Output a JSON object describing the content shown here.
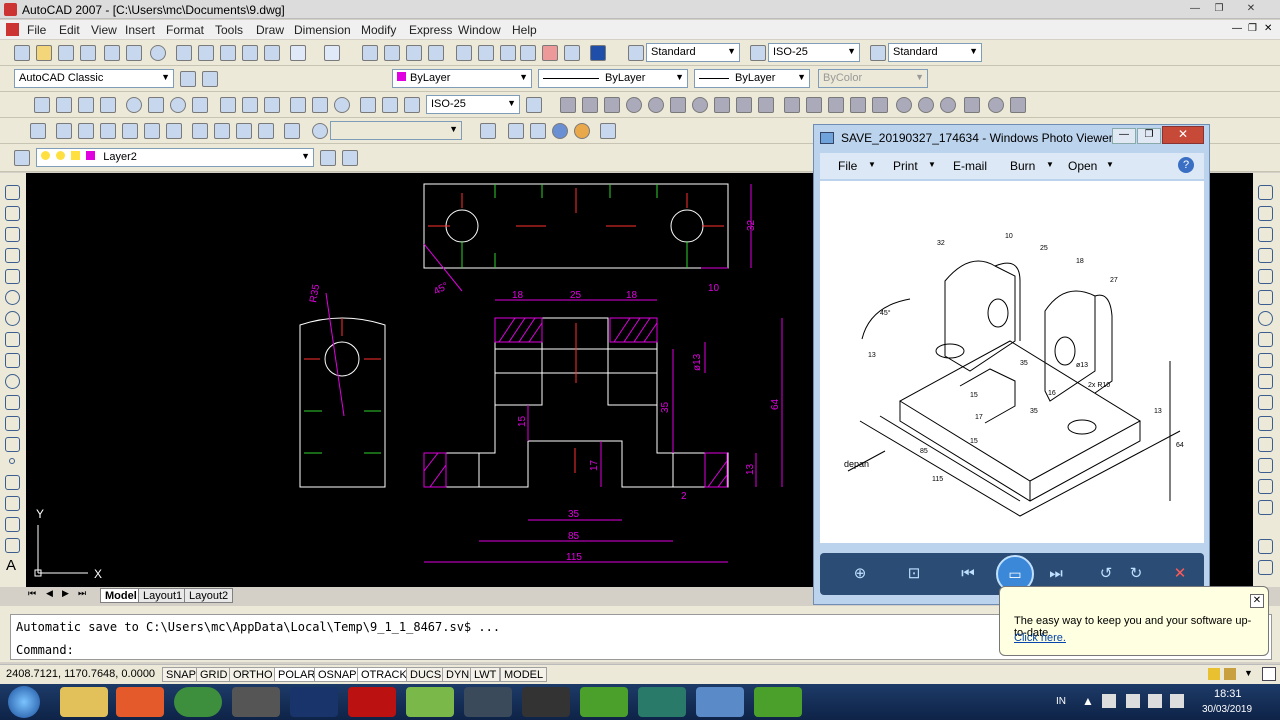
{
  "window": {
    "title": "AutoCAD 2007 - [C:\\Users\\mc\\Documents\\9.dwg]"
  },
  "menu": [
    "File",
    "Edit",
    "View",
    "Insert",
    "Format",
    "Tools",
    "Draw",
    "Dimension",
    "Modify",
    "Express",
    "Window",
    "Help"
  ],
  "toolbar": {
    "text_style": "Standard",
    "dim_style": "ISO-25",
    "table_style": "Standard",
    "workspace": "AutoCAD Classic",
    "color": "ByLayer",
    "linetype": "ByLayer",
    "lineweight": "ByLayer",
    "plot_style": "ByColor",
    "dim_style_2": "ISO-25",
    "layer": "Layer2"
  },
  "drawing": {
    "dims": [
      "32",
      "45°",
      "10",
      "R35",
      "18",
      "25",
      "18",
      "ø13",
      "35",
      "64",
      "15",
      "17",
      "13",
      "35",
      "85",
      "115",
      "2"
    ],
    "ucs_x": "X",
    "ucs_y": "Y"
  },
  "layout_tabs": [
    "Model",
    "Layout1",
    "Layout2"
  ],
  "command": {
    "history": "Automatic save to C:\\Users\\mc\\AppData\\Local\\Temp\\9_1_1_8467.sv$ ...",
    "prompt": "Command:"
  },
  "status": {
    "coords": "2408.7121, 1170.7648, 0.0000",
    "toggles": [
      "SNAP",
      "GRID",
      "ORTHO",
      "POLAR",
      "OSNAP",
      "OTRACK",
      "DUCS",
      "DYN",
      "LWT",
      "MODEL"
    ]
  },
  "photo_viewer": {
    "title": "SAVE_20190327_174634 - Windows Photo Viewer",
    "menu": [
      "File",
      "Print",
      "E-mail",
      "Burn",
      "Open"
    ],
    "image_dims": [
      "32",
      "10",
      "25",
      "18",
      "27",
      "45°",
      "13",
      "35",
      "15",
      "16",
      "17",
      "35",
      "15",
      "85",
      "115",
      "64",
      "13",
      "ø13",
      "2x R10"
    ],
    "depan_label": "depan"
  },
  "balloon": {
    "text": "The easy way to keep you and your software up-to-date.",
    "link": "Click here."
  },
  "tray": {
    "lang": "IN",
    "time": "18:31",
    "date": "30/03/2019"
  },
  "colors": {
    "canvas": "#000000",
    "magenta": "#ff00ff",
    "taskbar": "#1d3b68"
  }
}
